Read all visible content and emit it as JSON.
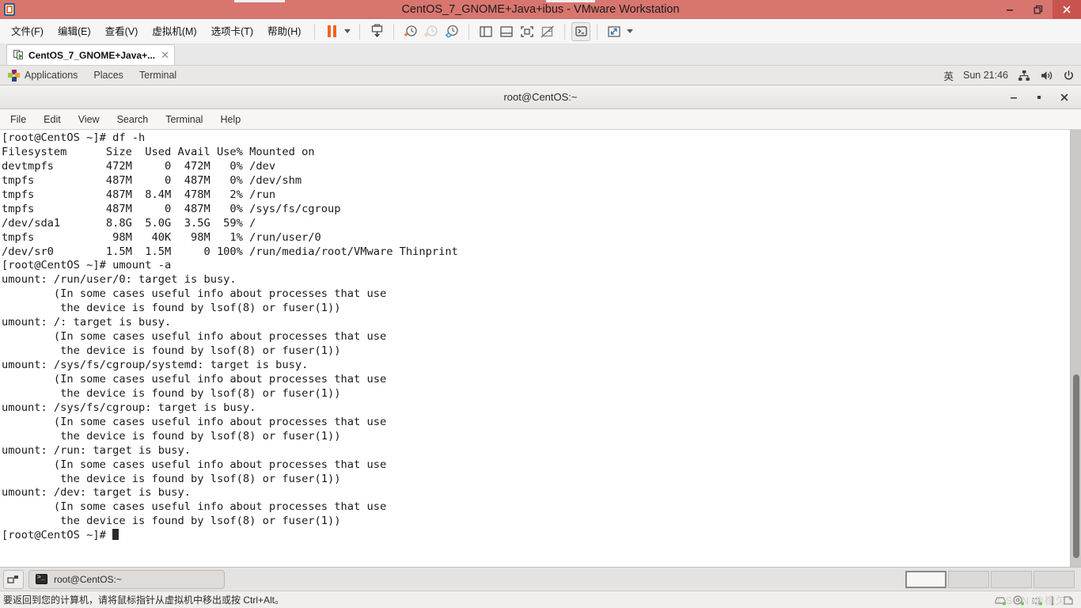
{
  "vmware": {
    "title": "CentOS_7_GNOME+Java+ibus - VMware Workstation",
    "logo_icon": "vmware-logo-icon",
    "window_controls": [
      {
        "name": "minimize-button",
        "icon": "minimize-icon",
        "label": "–"
      },
      {
        "name": "restore-button",
        "icon": "restore-icon",
        "label": "❐"
      },
      {
        "name": "close-button",
        "icon": "close-icon",
        "label": "✕"
      }
    ],
    "menu": [
      {
        "name": "menu-file",
        "label": "文件(F)"
      },
      {
        "name": "menu-edit",
        "label": "编辑(E)"
      },
      {
        "name": "menu-view",
        "label": "查看(V)"
      },
      {
        "name": "menu-vm",
        "label": "虚拟机(M)"
      },
      {
        "name": "menu-tabs",
        "label": "选项卡(T)"
      },
      {
        "name": "menu-help",
        "label": "帮助(H)"
      }
    ],
    "toolbar": [
      {
        "name": "suspend-button",
        "icon": "pause-icon"
      },
      {
        "name": "power-dropdown",
        "icon": "chevron-down-icon"
      },
      {
        "name": "snapshot-button",
        "icon": "snapshot-take-icon"
      },
      {
        "name": "snapshot-manager-button",
        "icon": "snapshot-clock-icon"
      },
      {
        "name": "revert-snapshot-button",
        "icon": "snapshot-revert-icon"
      },
      {
        "name": "manage-snapshots-button",
        "icon": "snapshot-settings-icon"
      },
      {
        "name": "show-sidebar-button",
        "icon": "panel-left-icon"
      },
      {
        "name": "show-thumbnail-bar-button",
        "icon": "panel-bottom-icon"
      },
      {
        "name": "fullscreen-button",
        "icon": "fullscreen-icon"
      },
      {
        "name": "unity-button",
        "icon": "unity-off-icon"
      },
      {
        "name": "console-button",
        "icon": "terminal-icon"
      },
      {
        "name": "stretch-button",
        "icon": "expand-arrows-icon"
      },
      {
        "name": "stretch-dropdown",
        "icon": "chevron-down-icon"
      }
    ],
    "tab": {
      "label": "CentOS_7_GNOME+Java+...",
      "close_label": "✕",
      "icon": "vm-running-icon"
    },
    "statusbar": {
      "text": "要返回到您的计算机，请将鼠标指针从虚拟机中移出或按 Ctrl+Alt。",
      "watermark": "CSDN @橡欠",
      "devices": [
        {
          "name": "hard-disk-device-icon",
          "icon": "hdd-icon"
        },
        {
          "name": "cdrom-device-icon",
          "icon": "disc-icon"
        },
        {
          "name": "network-device-icon",
          "icon": "network-icon"
        },
        {
          "name": "usb-device-icon",
          "icon": "usb-icon"
        },
        {
          "name": "printer-device-icon",
          "icon": "printer-icon"
        }
      ]
    },
    "colors": {
      "titlebar": "#d9756f",
      "close_button": "#c9534e",
      "accent_orange": "#f3641d"
    }
  },
  "gnome": {
    "topbar": {
      "applications_label": "Applications",
      "places_label": "Places",
      "terminal_label": "Terminal",
      "input_method": "英",
      "clock": "Sun 21:46",
      "icons": [
        {
          "name": "network-icon",
          "icon": "network-wired-icon"
        },
        {
          "name": "volume-icon",
          "icon": "speaker-icon"
        },
        {
          "name": "power-icon",
          "icon": "power-icon"
        }
      ]
    },
    "taskbar": {
      "show_desktop_label": "",
      "window_title": "root@CentOS:~",
      "workspaces": [
        {
          "name": "workspace-1",
          "active": true
        },
        {
          "name": "workspace-2",
          "active": false
        },
        {
          "name": "workspace-3",
          "active": false
        },
        {
          "name": "workspace-4",
          "active": false
        }
      ]
    }
  },
  "terminal": {
    "title": "root@CentOS:~",
    "window_controls": [
      {
        "name": "minimize-button",
        "label": "–"
      },
      {
        "name": "maximize-button",
        "label": "▪"
      },
      {
        "name": "close-button",
        "label": "✕"
      }
    ],
    "menu": [
      {
        "name": "terminal-menu-file",
        "label": "File"
      },
      {
        "name": "terminal-menu-edit",
        "label": "Edit"
      },
      {
        "name": "terminal-menu-view",
        "label": "View"
      },
      {
        "name": "terminal-menu-search",
        "label": "Search"
      },
      {
        "name": "terminal-menu-terminal",
        "label": "Terminal"
      },
      {
        "name": "terminal-menu-help",
        "label": "Help"
      }
    ],
    "prompt": "[root@CentOS ~]#",
    "lines": [
      "[root@CentOS ~]# df -h",
      "Filesystem      Size  Used Avail Use% Mounted on",
      "devtmpfs        472M     0  472M   0% /dev",
      "tmpfs           487M     0  487M   0% /dev/shm",
      "tmpfs           487M  8.4M  478M   2% /run",
      "tmpfs           487M     0  487M   0% /sys/fs/cgroup",
      "/dev/sda1       8.8G  5.0G  3.5G  59% /",
      "tmpfs            98M   40K   98M   1% /run/user/0",
      "/dev/sr0        1.5M  1.5M     0 100% /run/media/root/VMware Thinprint",
      "[root@CentOS ~]# umount -a",
      "umount: /run/user/0: target is busy.",
      "        (In some cases useful info about processes that use",
      "         the device is found by lsof(8) or fuser(1))",
      "umount: /: target is busy.",
      "        (In some cases useful info about processes that use",
      "         the device is found by lsof(8) or fuser(1))",
      "umount: /sys/fs/cgroup/systemd: target is busy.",
      "        (In some cases useful info about processes that use",
      "         the device is found by lsof(8) or fuser(1))",
      "umount: /sys/fs/cgroup: target is busy.",
      "        (In some cases useful info about processes that use",
      "         the device is found by lsof(8) or fuser(1))",
      "umount: /run: target is busy.",
      "        (In some cases useful info about processes that use",
      "         the device is found by lsof(8) or fuser(1))",
      "umount: /dev: target is busy.",
      "        (In some cases useful info about processes that use",
      "         the device is found by lsof(8) or fuser(1))"
    ],
    "last_line": "[root@CentOS ~]# ",
    "scrollbar": {
      "thumb_top_pct": 56,
      "thumb_height_pct": 42
    }
  }
}
